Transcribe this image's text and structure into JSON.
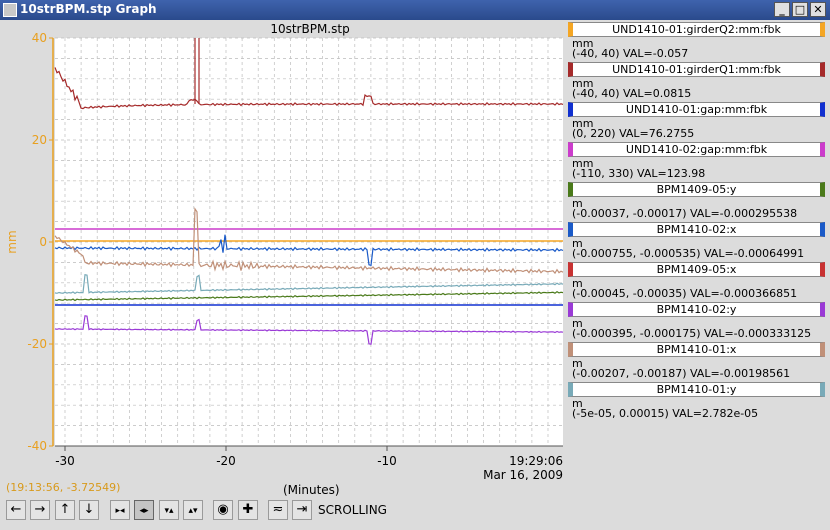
{
  "window": {
    "title": "10strBPM.stp Graph",
    "minimize": "_",
    "maximize": "□",
    "close": "✕"
  },
  "plot": {
    "title": "10strBPM.stp",
    "y_axis_unit": "mm",
    "y_ticks": [
      "40",
      "20",
      "0",
      "-20",
      "-40"
    ],
    "x_ticks": [
      "-30",
      "-20",
      "-10"
    ],
    "time_label": "19:29:06",
    "date_label": "Mar 16, 2009",
    "x_axis_label": "(Minutes)",
    "cursor_coords": "(19:13:56, -3.72549)",
    "colors": {
      "axis": "#e8a020",
      "grid": "#b8b8b8"
    }
  },
  "legend": [
    {
      "name": "UND1410-01:girderQ2:mm:fbk",
      "unit": "mm",
      "range": "(-40, 40) VAL=-0.057",
      "color": "#f5a623"
    },
    {
      "name": "UND1410-01:girderQ1:mm:fbk",
      "unit": "mm",
      "range": "(-40, 40) VAL=0.0815",
      "color": "#a52a2a"
    },
    {
      "name": "UND1410-01:gap:mm:fbk",
      "unit": "mm",
      "range": "(0, 220) VAL=76.2755",
      "color": "#1030d0"
    },
    {
      "name": "UND1410-02:gap:mm:fbk",
      "unit": "mm",
      "range": "(-110, 330) VAL=123.98",
      "color": "#cc3ccc"
    },
    {
      "name": "BPM1409-05:y",
      "unit": "m",
      "range": "(-0.00037, -0.00017) VAL=-0.000295538",
      "color": "#4a7a1a"
    },
    {
      "name": "BPM1410-02:x",
      "unit": "m",
      "range": "(-0.000755, -0.000535) VAL=-0.00064991",
      "color": "#1a5ac8"
    },
    {
      "name": "BPM1409-05:x",
      "unit": "m",
      "range": "(-0.00045, -0.00035) VAL=-0.000366851",
      "color": "#c83232"
    },
    {
      "name": "BPM1410-02:y",
      "unit": "m",
      "range": "(-0.000395, -0.000175) VAL=-0.000333125",
      "color": "#9a3ad6"
    },
    {
      "name": "BPM1410-01:x",
      "unit": "m",
      "range": "(-0.00207, -0.00187) VAL=-0.00198561",
      "color": "#c09078"
    },
    {
      "name": "BPM1410-01:y",
      "unit": "m",
      "range": "(-5e-05, 0.00015) VAL=2.782e-05",
      "color": "#78aab8"
    }
  ],
  "toolbar": {
    "buttons": [
      {
        "name": "scroll-left-button",
        "glyph": "←"
      },
      {
        "name": "scroll-right-button",
        "glyph": "→"
      },
      {
        "name": "scroll-up-button",
        "glyph": "↑"
      },
      {
        "name": "scroll-down-button",
        "glyph": "↓"
      },
      {
        "name": "zoom-x-in-button",
        "glyph": "▸◂"
      },
      {
        "name": "zoom-x-out-button",
        "glyph": "◂▸"
      },
      {
        "name": "zoom-y-in-button",
        "glyph": "▾▴"
      },
      {
        "name": "zoom-y-out-button",
        "glyph": "▴▾"
      },
      {
        "name": "pan-button",
        "glyph": "◉"
      },
      {
        "name": "zoom-box-button",
        "glyph": "✚"
      },
      {
        "name": "auto-scale-button",
        "glyph": "≂"
      },
      {
        "name": "back-to-scroll-button",
        "glyph": "⇥"
      }
    ],
    "mode_label": "SCROLLING"
  }
}
